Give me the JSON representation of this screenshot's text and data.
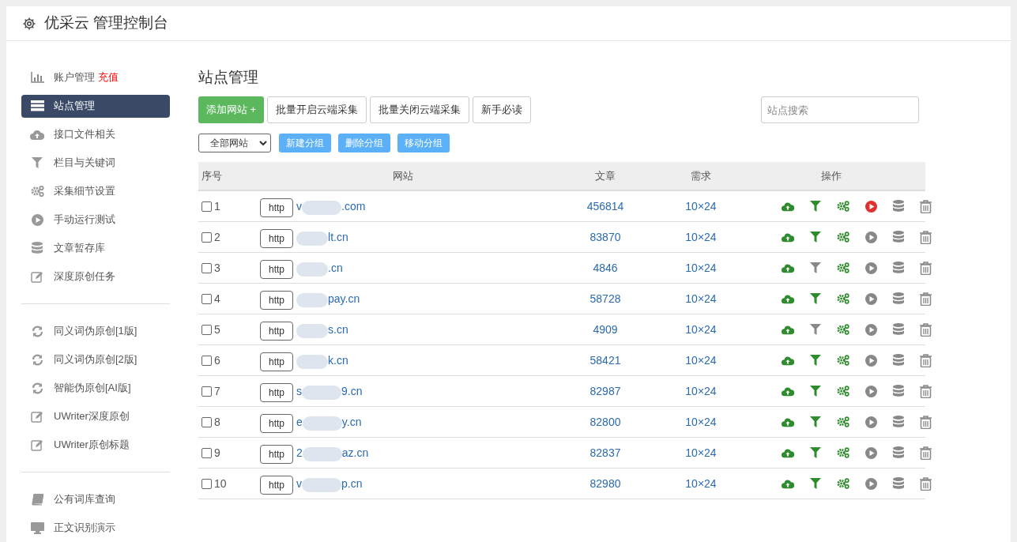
{
  "header": {
    "title": "优采云 管理控制台"
  },
  "sidebar": {
    "groups": [
      [
        {
          "label": "账户管理",
          "badge": "充值",
          "selected": false
        },
        {
          "label": "站点管理",
          "selected": true
        },
        {
          "label": "接口文件相关",
          "selected": false
        },
        {
          "label": "栏目与关键词",
          "selected": false
        },
        {
          "label": "采集细节设置",
          "selected": false
        },
        {
          "label": "手动运行测试",
          "selected": false
        },
        {
          "label": "文章暂存库",
          "selected": false
        },
        {
          "label": "深度原创任务",
          "selected": false
        }
      ],
      [
        {
          "label": "同义词伪原创[1版]",
          "selected": false
        },
        {
          "label": "同义词伪原创[2版]",
          "selected": false
        },
        {
          "label": "智能伪原创[AI版]",
          "selected": false
        },
        {
          "label": "UWriter深度原创",
          "selected": false
        },
        {
          "label": "UWriter原创标题",
          "selected": false
        }
      ],
      [
        {
          "label": "公有词库查询",
          "selected": false
        },
        {
          "label": "正文识别演示",
          "selected": false
        }
      ]
    ]
  },
  "content": {
    "title": "站点管理",
    "add_button": "添加网站 +",
    "buttons": [
      "批量开启云端采集",
      "批量关闭云端采集",
      "新手必读"
    ],
    "search": {
      "placeholder": "站点搜索"
    },
    "group_select": "全部网站",
    "group_buttons": [
      "新建分组",
      "删除分组",
      "移动分组"
    ],
    "table": {
      "columns": [
        "序号",
        "网站",
        "文章",
        "需求",
        "操作"
      ],
      "rows": [
        {
          "checked": false,
          "index": "1",
          "protocol": "http",
          "site_start": "v",
          "site_end": ".com",
          "articles": "456814",
          "demand": "10×24",
          "filter_on": true,
          "running": true
        },
        {
          "checked": false,
          "index": "2",
          "protocol": "http",
          "site_end": "lt.cn",
          "articles": "83870",
          "demand": "10×24",
          "filter_on": true,
          "running": false
        },
        {
          "checked": false,
          "index": "3",
          "protocol": "http",
          "site_end": ".cn",
          "articles": "4846",
          "demand": "10×24",
          "filter_on": false,
          "running": false
        },
        {
          "checked": false,
          "index": "4",
          "protocol": "http",
          "site_end": "pay.cn",
          "articles": "58728",
          "demand": "10×24",
          "filter_on": true,
          "running": false
        },
        {
          "checked": false,
          "index": "5",
          "protocol": "http",
          "site_end": "s.cn",
          "articles": "4909",
          "demand": "10×24",
          "filter_on": false,
          "running": false
        },
        {
          "checked": false,
          "index": "6",
          "protocol": "http",
          "site_end": "k.cn",
          "articles": "58421",
          "demand": "10×24",
          "filter_on": true,
          "running": false
        },
        {
          "checked": false,
          "index": "7",
          "protocol": "http",
          "site_start": "s",
          "site_end": "9.cn",
          "articles": "82987",
          "demand": "10×24",
          "filter_on": true,
          "running": false
        },
        {
          "checked": false,
          "index": "8",
          "protocol": "http",
          "site_start": "e",
          "site_end": "y.cn",
          "articles": "82800",
          "demand": "10×24",
          "filter_on": true,
          "running": false
        },
        {
          "checked": false,
          "index": "9",
          "protocol": "http",
          "site_start": "2",
          "site_end": "az.cn",
          "articles": "82837",
          "demand": "10×24",
          "filter_on": true,
          "running": false
        },
        {
          "checked": false,
          "index": "10",
          "protocol": "http",
          "site_start": "v",
          "site_end": "p.cn",
          "articles": "82980",
          "demand": "10×24",
          "filter_on": true,
          "running": false
        }
      ]
    }
  }
}
